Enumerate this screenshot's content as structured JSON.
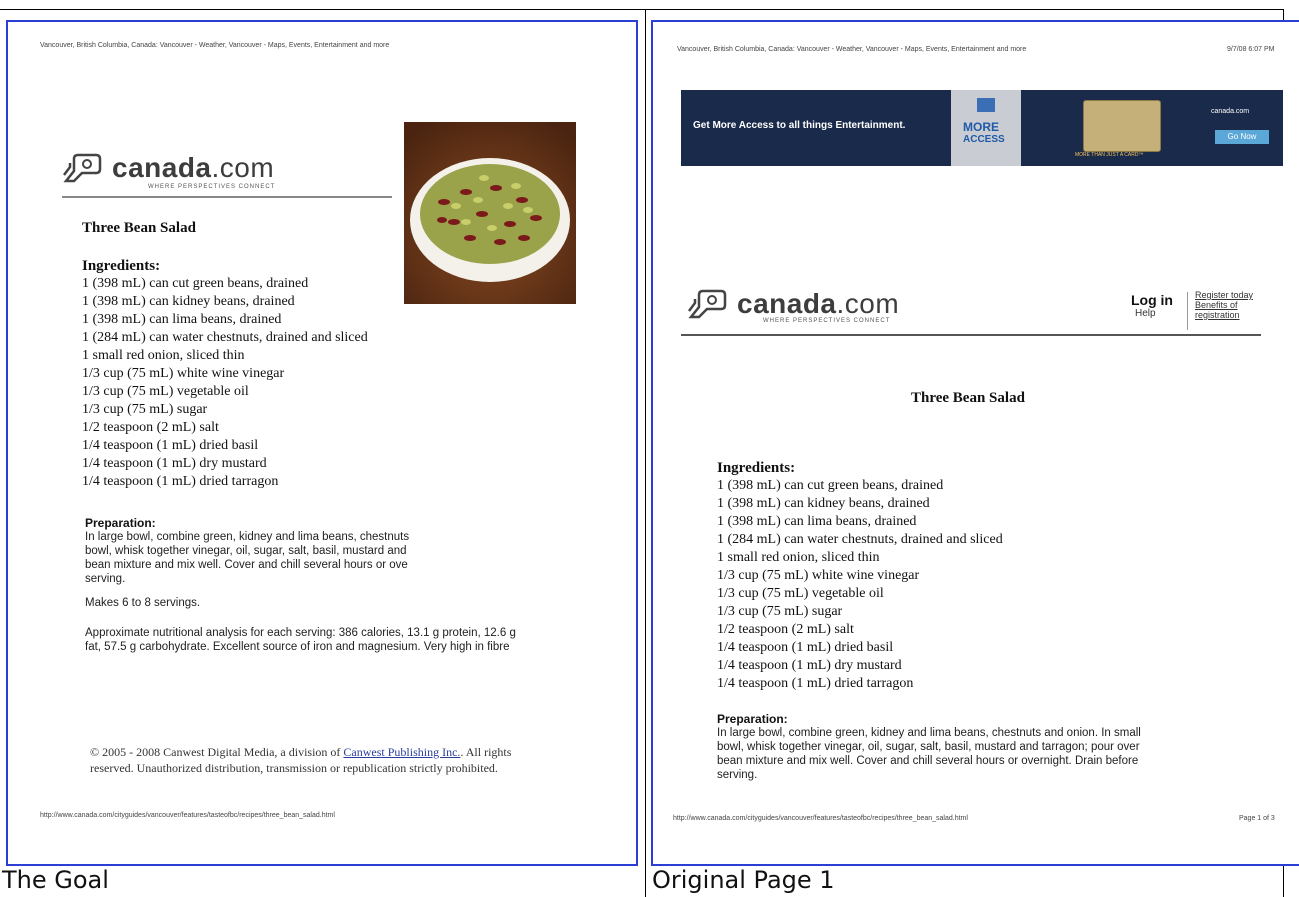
{
  "captions": {
    "left": "The Goal",
    "right": "Original Page 1"
  },
  "goal": {
    "header": "Vancouver, British Columbia, Canada: Vancouver - Weather, Vancouver - Maps, Events, Entertainment and more",
    "logo": {
      "word": "canada",
      "suffix": ".com",
      "tagline": "WHERE PERSPECTIVES CONNECT"
    },
    "title": "Three Bean Salad",
    "ingredients_head": "Ingredients:",
    "ingredients": [
      "1 (398 mL) can cut green beans, drained",
      "1 (398 mL) can kidney beans, drained",
      "1 (398 mL) can lima beans, drained",
      "1 (284 mL) can water chestnuts, drained and sliced",
      "1 small red onion, sliced thin",
      "1/3 cup (75 mL) white wine vinegar",
      "1/3 cup (75 mL) vegetable oil",
      "1/3 cup (75 mL) sugar",
      "1/2 teaspoon (2 mL) salt",
      "1/4 teaspoon (1 mL) dried basil",
      "1/4 teaspoon (1 mL) dry mustard",
      "1/4 teaspoon (1 mL) dried tarragon"
    ],
    "prep_head": "Preparation:",
    "prep_lines": [
      "In large bowl, combine green, kidney and lima beans, chestnuts",
      "bowl, whisk together vinegar, oil, sugar, salt, basil, mustard and",
      "bean mixture and mix well. Cover and chill several hours or ove",
      "serving."
    ],
    "makes": "Makes 6 to 8 servings.",
    "nutrition_1": "Approximate nutritional analysis for each serving: 386 calories, 13.1 g protein, 12.6 g",
    "nutrition_2": "fat, 57.5 g carbohydrate. Excellent source of iron and magnesium. Very high in fibre",
    "copyright_pre": "© 2005 - 2008 Canwest Digital Media, a division of ",
    "copyright_link": "Canwest Publishing Inc.",
    "copyright_post": ". All rights",
    "copyright_2": "reserved. Unauthorized distribution, transmission or republication strictly prohibited.",
    "footer_url": "http://www.canada.com/cityguides/vancouver/features/tasteofbc/recipes/three_bean_salad.html"
  },
  "original": {
    "header": "Vancouver, British Columbia, Canada: Vancouver - Weather, Vancouver - Maps, Events, Entertainment and more",
    "timestamp": "9/7/08 6:07 PM",
    "banner": {
      "text": "Get More Access to all things Entertainment.",
      "more": "MORE",
      "access": "ACCESS",
      "card_tag": "MORE THAN JUST A CARD™",
      "brand": "canada.com",
      "go": "Go Now"
    },
    "logo": {
      "word": "canada",
      "suffix": ".com",
      "tagline": "WHERE PERSPECTIVES CONNECT"
    },
    "login": {
      "log_in": "Log in",
      "help": "Help",
      "register": "Register today",
      "benefits": "Benefits of registration"
    },
    "title": "Three Bean Salad",
    "ingredients_head": "Ingredients:",
    "ingredients": [
      "1 (398 mL) can cut green beans, drained",
      "1 (398 mL) can kidney beans, drained",
      "1 (398 mL) can lima beans, drained",
      "1 (284 mL) can water chestnuts, drained and sliced",
      "1 small red onion, sliced thin",
      "1/3 cup (75 mL) white wine vinegar",
      "1/3 cup (75 mL) vegetable oil",
      "1/3 cup (75 mL) sugar",
      "1/2 teaspoon (2 mL) salt",
      "1/4 teaspoon (1 mL) dried basil",
      "1/4 teaspoon (1 mL) dry mustard",
      "1/4 teaspoon (1 mL) dried tarragon"
    ],
    "prep_head": "Preparation:",
    "prep_lines": [
      "In large bowl, combine green, kidney and lima beans, chestnuts and onion. In small",
      "bowl, whisk together vinegar, oil, sugar, salt, basil, mustard and tarragon; pour over",
      "bean mixture and mix well. Cover and chill several hours or overnight. Drain before",
      "serving."
    ],
    "footer_url": "http://www.canada.com/cityguides/vancouver/features/tasteofbc/recipes/three_bean_salad.html",
    "page": "Page 1 of 3"
  },
  "colors": {
    "pane_border": "#2b3fd6",
    "banner_bg": "#1a2a4a",
    "bowl": "#6b3a1d"
  }
}
